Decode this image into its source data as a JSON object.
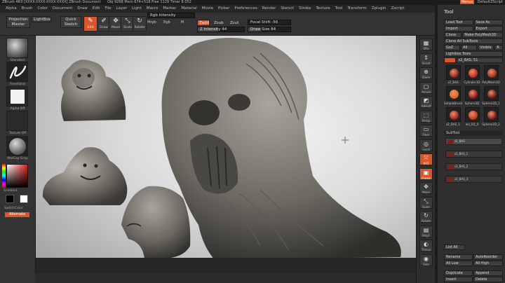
{
  "window": {
    "title": "ZBrush 4R3 [XXXX-XXXX-XXXX-XXXX]   ZBrush Document",
    "stats": "Obj 9268  Mem 674+516  Free 1129  Timer 8.052",
    "menus_button": "Menus",
    "script_label": "DefaultZScript"
  },
  "menubar": {
    "items": [
      "Alpha",
      "Brush",
      "Color",
      "Document",
      "Draw",
      "Edit",
      "File",
      "Layer",
      "Light",
      "Macro",
      "Marker",
      "Material",
      "Movie",
      "Picker",
      "Preferences",
      "Render",
      "Stencil",
      "Stroke",
      "Texture",
      "Tool",
      "Transform",
      "Zplugin",
      "Zscript"
    ]
  },
  "toolbar": {
    "projection_master": "Projection Master",
    "lightbox": "LightBox",
    "quick_sketch": "Quick Sketch",
    "edit": "Edit",
    "draw": "Draw",
    "move": "Move",
    "scale": "Scale",
    "rotate": "Rotate",
    "mrgb": "Mrgb",
    "rgb": "Rgb",
    "m": "M",
    "zadd": "Zadd",
    "zsub": "Zsub",
    "zcut": "Zcut",
    "rgb_intensity": "Rgb Intensity",
    "z_intensity": "Z Intensity 44",
    "focal_shift": "Focal Shift -56",
    "draw_size": "Draw Size 84",
    "z_intensity_level": 0.44,
    "draw_size_level": 0.3
  },
  "left_panel": {
    "brush_label": "Standard",
    "stroke_label": "FreeHand",
    "alpha_label": "Alpha Off",
    "texture_label": "Texture Off",
    "material_label": "MatCap Gray",
    "gradient": "Gradient",
    "switch_color": "SwitchColor",
    "alternate": "Alternate"
  },
  "right_strip": {
    "buttons": [
      "SPix",
      "Scroll",
      "Zoom",
      "Actual",
      "AAHalf",
      "Persp",
      "Floor",
      "Local",
      "XYZ",
      "Frame",
      "Move",
      "Scale",
      "Rotate",
      "PolyF",
      "Transp",
      "Solo"
    ]
  },
  "tool_panel": {
    "title": "Tool",
    "load_tool": "Load Tool",
    "save_as": "Save As",
    "import": "Import",
    "export": "Export",
    "clone": "Clone",
    "make_polymesh": "Make PolyMesh3D",
    "clone_all_subtools": "Clone All SubTools",
    "goz": "GoZ",
    "all": "All",
    "visible": "Visible",
    "r": "R",
    "lightbox_tools": "Lightbox  Tools",
    "current_tool": "z2_BAS. 51",
    "tools": [
      "z2_BAS",
      "Cylinder3D",
      "PolyMesh3D",
      "SimpleBrush",
      "Sphere3D",
      "Sphere3D_1",
      "z2_BAS_1",
      "Vol_D1_0",
      "Sphere3D_2"
    ],
    "subtool_header": "SubTool",
    "subtools": [
      "z2_BAS",
      "z2_BAS_1",
      "z2_BAS_2",
      "z2_BAS_3"
    ],
    "list_all": "List All",
    "rename": "Rename",
    "autoreorder": "AutoReorder",
    "all_low": "All Low",
    "all_high": "All High",
    "duplicate": "Duplicate",
    "append": "Append",
    "insert": "Insert",
    "delete": "Delete"
  },
  "colors": {
    "accent": "#d9552b",
    "panel": "#333333",
    "canvas_light": "#f4f4f4",
    "canvas_dark": "#9d9d9d"
  }
}
